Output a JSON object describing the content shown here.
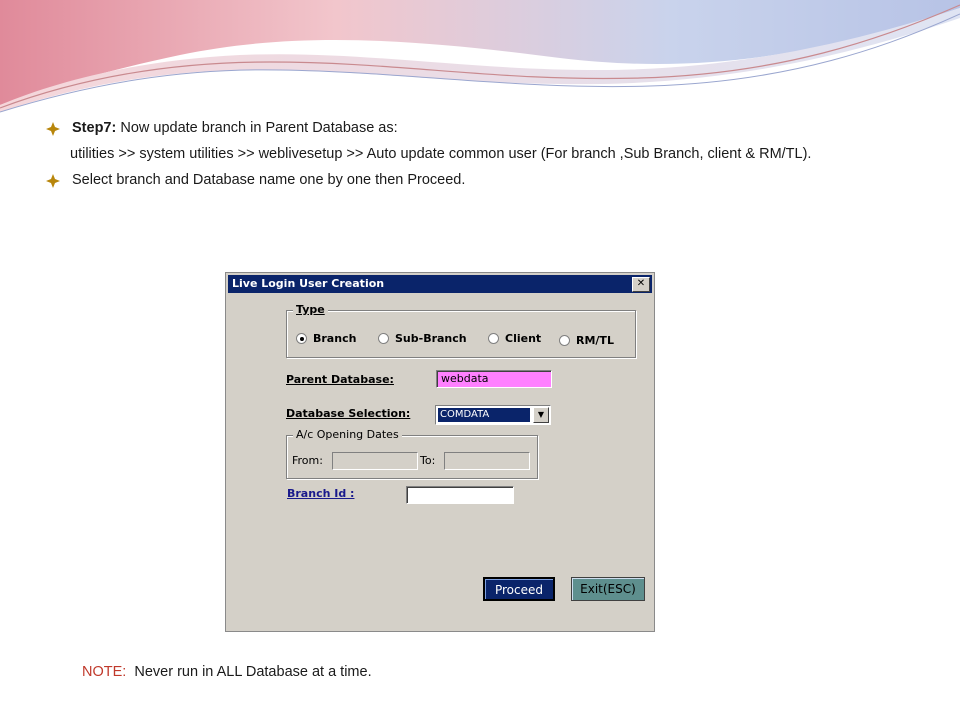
{
  "slide": {
    "bullet1": {
      "bold": "Step7:",
      "text": "Now update branch in Parent Database as:"
    },
    "bullet1_detail": "utilities >> system utilities >> weblivesetup >> Auto update common user (For branch ,Sub Branch, client & RM/TL).",
    "bullet2": "Select branch and Database name one by one then Proceed.",
    "note_label": "NOTE:",
    "note_text": "Never run in ALL Database at a time."
  },
  "dialog": {
    "title": "Live Login User Creation",
    "close": "✕",
    "type_group": {
      "legend": "Type",
      "options": [
        {
          "label": "Branch",
          "selected": true
        },
        {
          "label": "Sub-Branch",
          "selected": false
        },
        {
          "label": "Client",
          "selected": false
        },
        {
          "label": "RM/TL",
          "selected": false
        }
      ]
    },
    "parent_db_label": "Parent Database:",
    "parent_db_value": "webdata",
    "db_selection_label": "Database Selection:",
    "db_selection_value": "COMDATA",
    "dates_group": {
      "legend": "A/c Opening Dates",
      "from_label": "From:",
      "to_label": "To:"
    },
    "branch_id_label": "Branch Id :",
    "branch_id_value": "",
    "proceed_label": "Proceed",
    "exit_label": "Exit(ESC)"
  },
  "colors": {
    "titlebar": "#0a246a",
    "dialog_bg": "#d4d0c8",
    "parent_db_field": "#ff80ff",
    "link_label": "#1a1a8c",
    "note_label": "#c0392b",
    "bullet_diamond": "#b8860b"
  }
}
